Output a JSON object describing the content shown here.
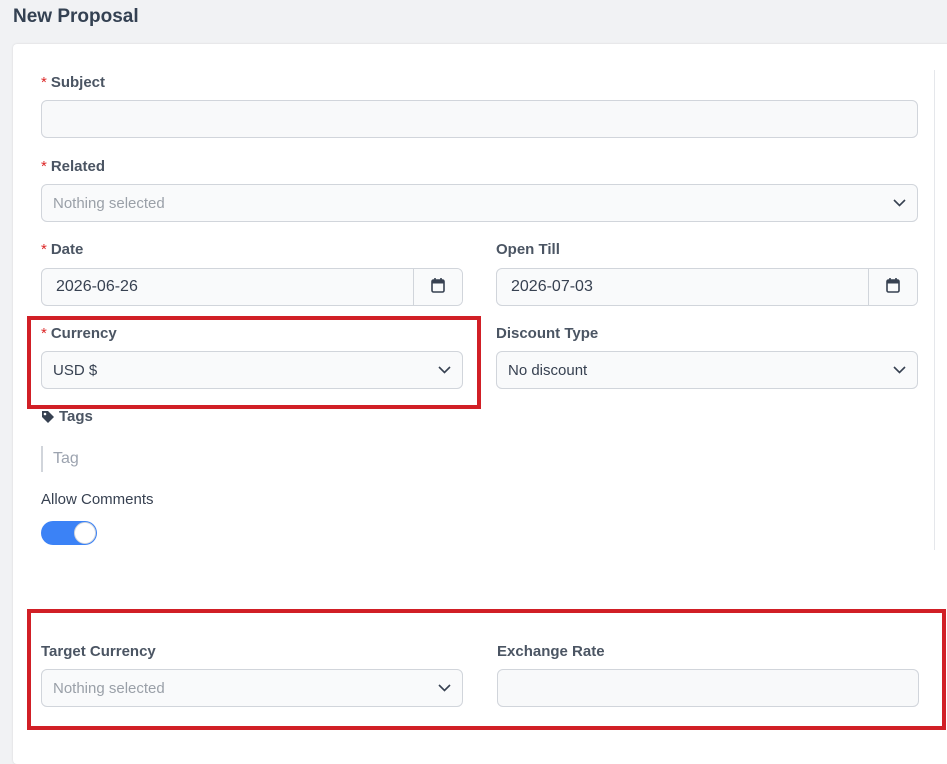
{
  "page": {
    "title": "New Proposal"
  },
  "form": {
    "required_marker": "*",
    "subject": {
      "label": "Subject",
      "value": ""
    },
    "related": {
      "label": "Related",
      "placeholder": "Nothing selected"
    },
    "date": {
      "label": "Date",
      "value": "2026-06-26"
    },
    "open_till": {
      "label": "Open Till",
      "value": "2026-07-03"
    },
    "currency": {
      "label": "Currency",
      "value": "USD $"
    },
    "discount_type": {
      "label": "Discount Type",
      "value": "No discount"
    },
    "tags": {
      "label": "Tags",
      "placeholder": "Tag"
    },
    "allow_comments": {
      "label": "Allow Comments",
      "enabled": true
    },
    "target_currency": {
      "label": "Target Currency",
      "placeholder": "Nothing selected"
    },
    "exchange_rate": {
      "label": "Exchange Rate",
      "value": ""
    }
  },
  "colors": {
    "highlight": "#d11f26",
    "toggle_on": "#3b82f6",
    "required": "#dc2626"
  },
  "icons": [
    "chevron-down-icon",
    "calendar-icon",
    "tag-icon"
  ]
}
